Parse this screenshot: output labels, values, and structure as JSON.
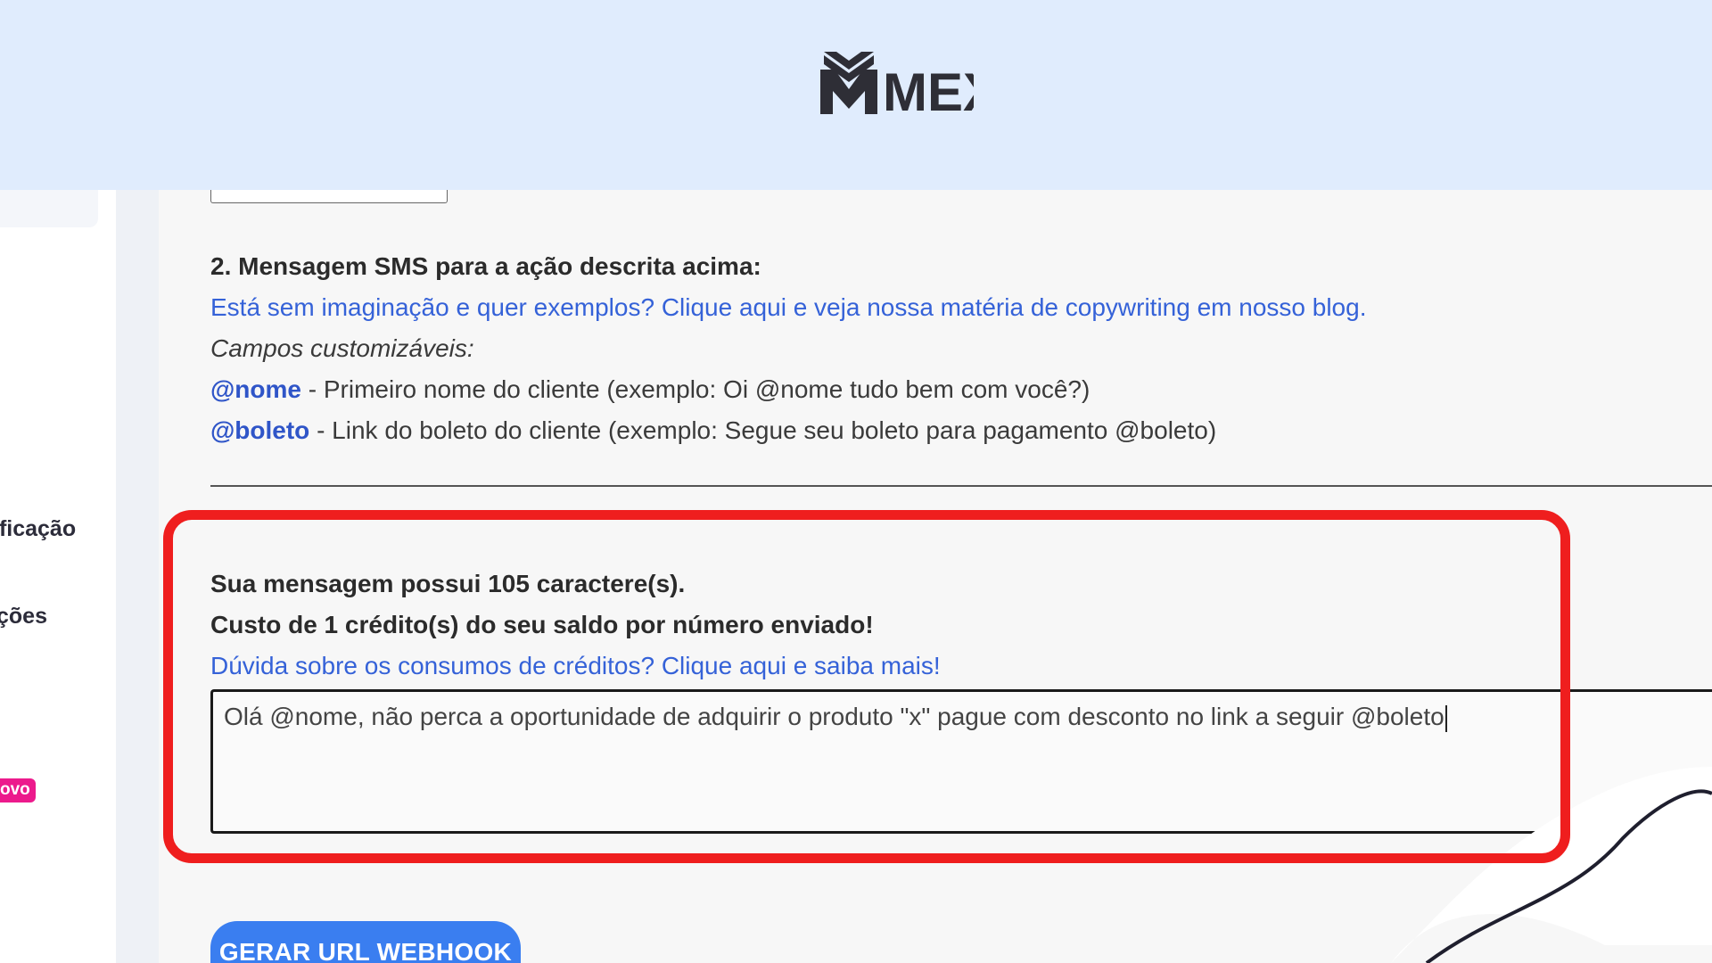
{
  "brand": {
    "logo_text": "MEX"
  },
  "sidebar": {
    "items": [
      {
        "label": "ificação"
      },
      {
        "label": "ções"
      }
    ],
    "badge": "ovo"
  },
  "main": {
    "section_heading": "2. Mensagem SMS para a ação descrita acima:",
    "examples_link": "Está sem imaginação e quer exemplos? Clique aqui e veja nossa matéria de copywriting em nosso blog.",
    "custom_fields_title": "Campos customizáveis:",
    "custom_fields": [
      {
        "tag": "@nome",
        "description": " - Primeiro nome do cliente (exemplo: Oi @nome tudo bem com você?)"
      },
      {
        "tag": "@boleto",
        "description": " - Link do boleto do cliente (exemplo: Segue seu boleto para pagamento @boleto)"
      }
    ],
    "char_count_text": "Sua mensagem possui 105 caractere(s).",
    "cost_text": "Custo de 1 crédito(s) do seu saldo por número enviado!",
    "credits_link": "Dúvida sobre os consumos de créditos? Clique aqui e saiba mais!",
    "message_value": "Olá @nome, não perca a oportunidade de adquirir o produto \"x\" pague com desconto no link a seguir @boleto",
    "webhook_button": "GERAR URL WEBHOOK"
  },
  "colors": {
    "header_bg": "#e0ecfd",
    "link": "#3562d8",
    "highlight": "#ef1e1e",
    "button": "#3a7ef0",
    "badge": "#ec1a8c"
  }
}
